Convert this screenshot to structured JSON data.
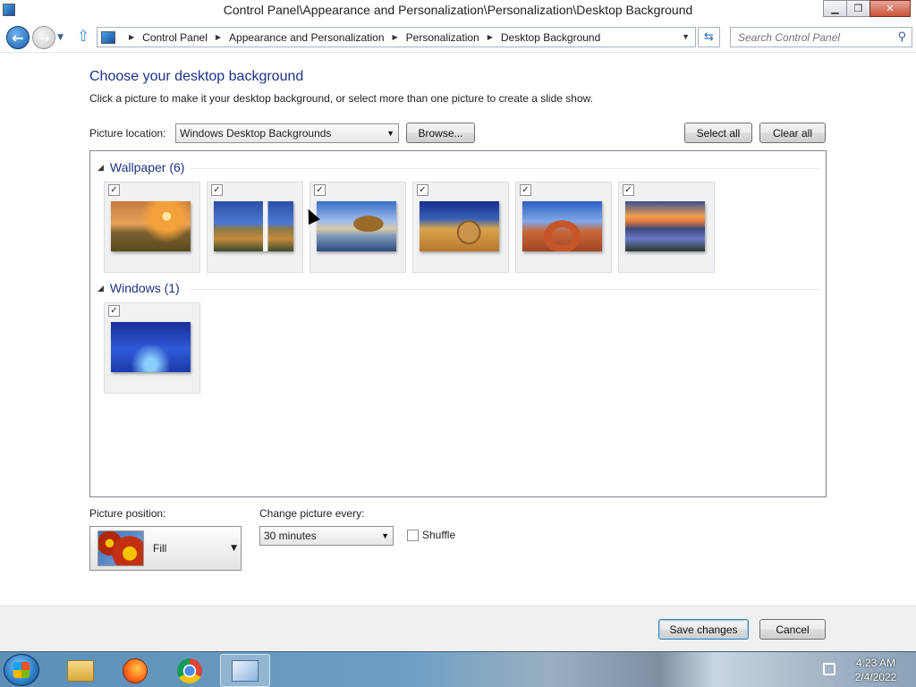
{
  "window": {
    "title": "Control Panel\\Appearance and Personalization\\Personalization\\Desktop Background",
    "minimize_icon": "minimize-icon",
    "restore_icon": "restore-icon",
    "close_icon": "close-icon"
  },
  "address_bar": {
    "breadcrumbs": [
      "Control Panel",
      "Appearance and Personalization",
      "Personalization",
      "Desktop Background"
    ],
    "search_placeholder": "Search Control Panel"
  },
  "page": {
    "heading": "Choose your desktop background",
    "description": "Click a picture to make it your desktop background, or select more than one picture to create a slide show.",
    "picture_location_label": "Picture location:",
    "picture_location_value": "Windows Desktop Backgrounds",
    "browse_label": "Browse...",
    "select_all_label": "Select all",
    "clear_all_label": "Clear all"
  },
  "gallery": {
    "groups": [
      {
        "name": "Wallpaper (6)",
        "items": [
          {
            "checked": true,
            "thumb": "sunset-field"
          },
          {
            "checked": true,
            "thumb": "lighthouse"
          },
          {
            "checked": true,
            "thumb": "haystack-rock"
          },
          {
            "checked": true,
            "thumb": "hay-bale"
          },
          {
            "checked": true,
            "thumb": "delicate-arch"
          },
          {
            "checked": true,
            "thumb": "lupine-lake"
          }
        ]
      },
      {
        "name": "Windows (1)",
        "items": [
          {
            "checked": true,
            "thumb": "windows-blue"
          }
        ]
      }
    ]
  },
  "options": {
    "picture_position_label": "Picture position:",
    "picture_position_value": "Fill",
    "change_picture_label": "Change picture every:",
    "change_picture_value": "30 minutes",
    "shuffle_label": "Shuffle",
    "shuffle_checked": false
  },
  "footer": {
    "save_label": "Save changes",
    "cancel_label": "Cancel"
  },
  "taskbar": {
    "time": "4:23 AM",
    "date": "2/4/2022",
    "items": [
      "file-explorer-icon",
      "firefox-icon",
      "chrome-icon",
      "control-panel-icon"
    ]
  },
  "colors": {
    "heading": "#1e3287",
    "group_header": "#1e3287"
  }
}
